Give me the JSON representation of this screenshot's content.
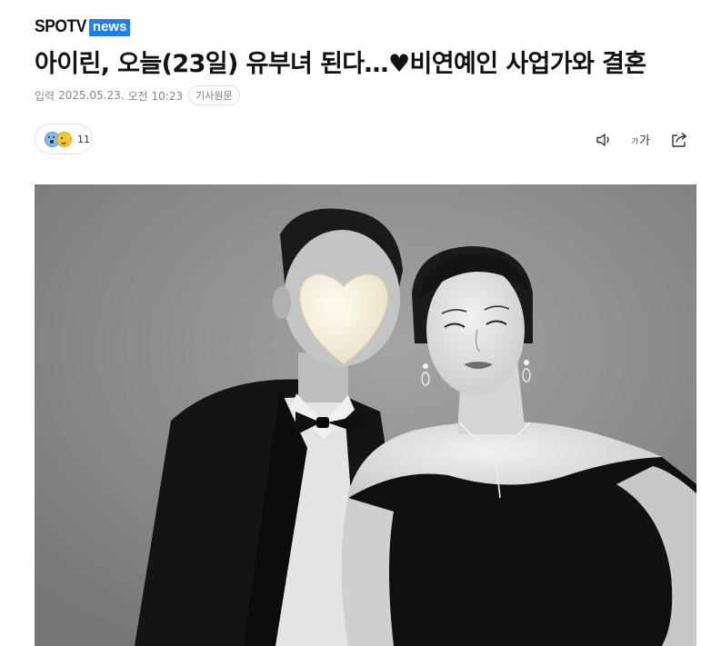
{
  "logo": {
    "brand": "SPOTV",
    "suffix": "news"
  },
  "article": {
    "headline": "아이린, 오늘(23일) 유부녀 된다…♥비연예인 사업가와 결혼",
    "meta": {
      "label": "입력",
      "date": "2025.05.23.",
      "time": "오전 10:23",
      "origin_button": "기사원문"
    }
  },
  "reactions": {
    "icons": [
      "surprised-emoji",
      "wink-emoji"
    ],
    "count": "11"
  },
  "toolbar": {
    "font_small": "가",
    "font_large": "가",
    "icons": [
      "speaker-icon",
      "font-size-icon",
      "share-icon"
    ]
  },
  "photo": {
    "description_icon": "heart-sticker"
  },
  "colors": {
    "brand_blue": "#1d7ff0",
    "text_primary": "#111111",
    "text_meta": "#888888"
  }
}
